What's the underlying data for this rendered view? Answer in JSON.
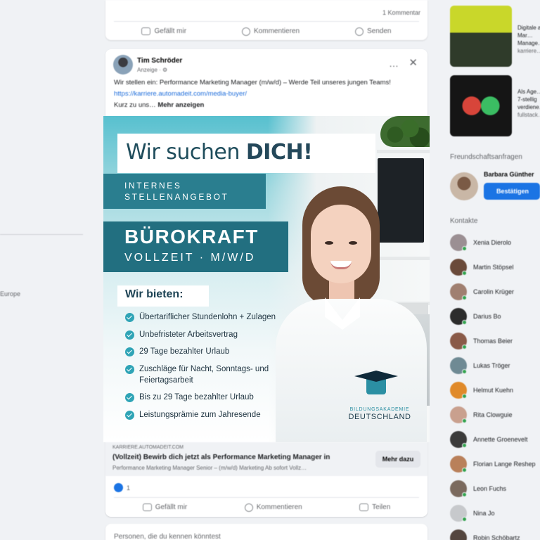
{
  "left_sidebar": {
    "items": [
      "Europe"
    ]
  },
  "prev_card": {
    "comment_count": "1 Kommentar",
    "actions": {
      "like": "Gefällt mir",
      "comment": "Kommentieren",
      "share": "Senden"
    }
  },
  "post": {
    "author": "Tim Schröder",
    "meta": "Anzeige · ⚙",
    "text": "Wir stellen ein: Performance Marketing Manager (m/w/d) – Werde Teil unseres jungen Teams!",
    "link": "https://karriere.automadeit.com/media-buyer/",
    "text_short": "Kurz zu uns…",
    "more_label": "Mehr anzeigen",
    "more_icon": "…",
    "close_icon": "✕"
  },
  "creative": {
    "title_part1": "Wir suchen ",
    "title_bold": "DICH!",
    "tag_line1": "INTERNES",
    "tag_line2": "STELLENANGEBOT",
    "job_title": "BÜROKRAFT",
    "job_sub": "VOLLZEIT · M/W/D",
    "offer_title": "Wir bieten:",
    "benefits": [
      "Übertariflicher Stundenlohn + Zulagen",
      "Unbefristeter Arbeitsvertrag",
      "29 Tage bezahlter Urlaub",
      "Zuschläge für Nacht, Sonntags- und Feiertagsarbeit",
      "Bis zu 29 Tage bezahlter Urlaub",
      "Leistungsprämie zum Jahresende"
    ],
    "logo_line1": "BILDUNGSAKADEMIE",
    "logo_line2": "DEUTSCHLAND"
  },
  "link_preview": {
    "domain": "KARRIERE.AUTOMADEIT.COM",
    "title": "(Vollzeit) Bewirb dich jetzt als Performance Marketing Manager in",
    "description": "Performance Marketing Manager Senior – (m/w/d) Marketing Ab sofort Vollz…",
    "button": "Mehr dazu"
  },
  "reactions": {
    "count": "1"
  },
  "post_actions": {
    "like": "Gefällt mir",
    "comment": "Kommentieren",
    "share": "Teilen"
  },
  "next_card": {
    "title": "Personen, die du kennen könntest"
  },
  "right": {
    "sponsored": [
      {
        "caption": "Digitale als Mar… Manage…",
        "sub": "karriere…"
      },
      {
        "caption": "Als Age… 7-stellig verdiene…",
        "sub": "fullstack…"
      }
    ],
    "requests_title": "Freundschaftsanfragen",
    "request": {
      "name": "Barbara Günther",
      "button": "Bestätigen"
    },
    "contacts_title": "Kontakte",
    "contacts": [
      {
        "name": "Xenia Dierolo",
        "color": "#9b8f93"
      },
      {
        "name": "Martin Stöpsel",
        "color": "#6a4a3a"
      },
      {
        "name": "Carolin Krüger",
        "color": "#a07f70"
      },
      {
        "name": "Darius Bo",
        "color": "#2c2c2c"
      },
      {
        "name": "Thomas Beier",
        "color": "#8a5a48"
      },
      {
        "name": "Lukas Tröger",
        "color": "#6f8a94"
      },
      {
        "name": "Helmut Kuehn",
        "color": "#e08a2a"
      },
      {
        "name": "Rita Clowguie",
        "color": "#c9a08e"
      },
      {
        "name": "Annette Groenevelt",
        "color": "#3b3b3b"
      },
      {
        "name": "Florian Lange Reshep",
        "color": "#b9805a"
      },
      {
        "name": "Leon Fuchs",
        "color": "#7b6a5e"
      },
      {
        "name": "Nina Jo",
        "color": "#c7c9cc"
      },
      {
        "name": "Robin Schöbartz",
        "color": "#54463f"
      }
    ]
  }
}
